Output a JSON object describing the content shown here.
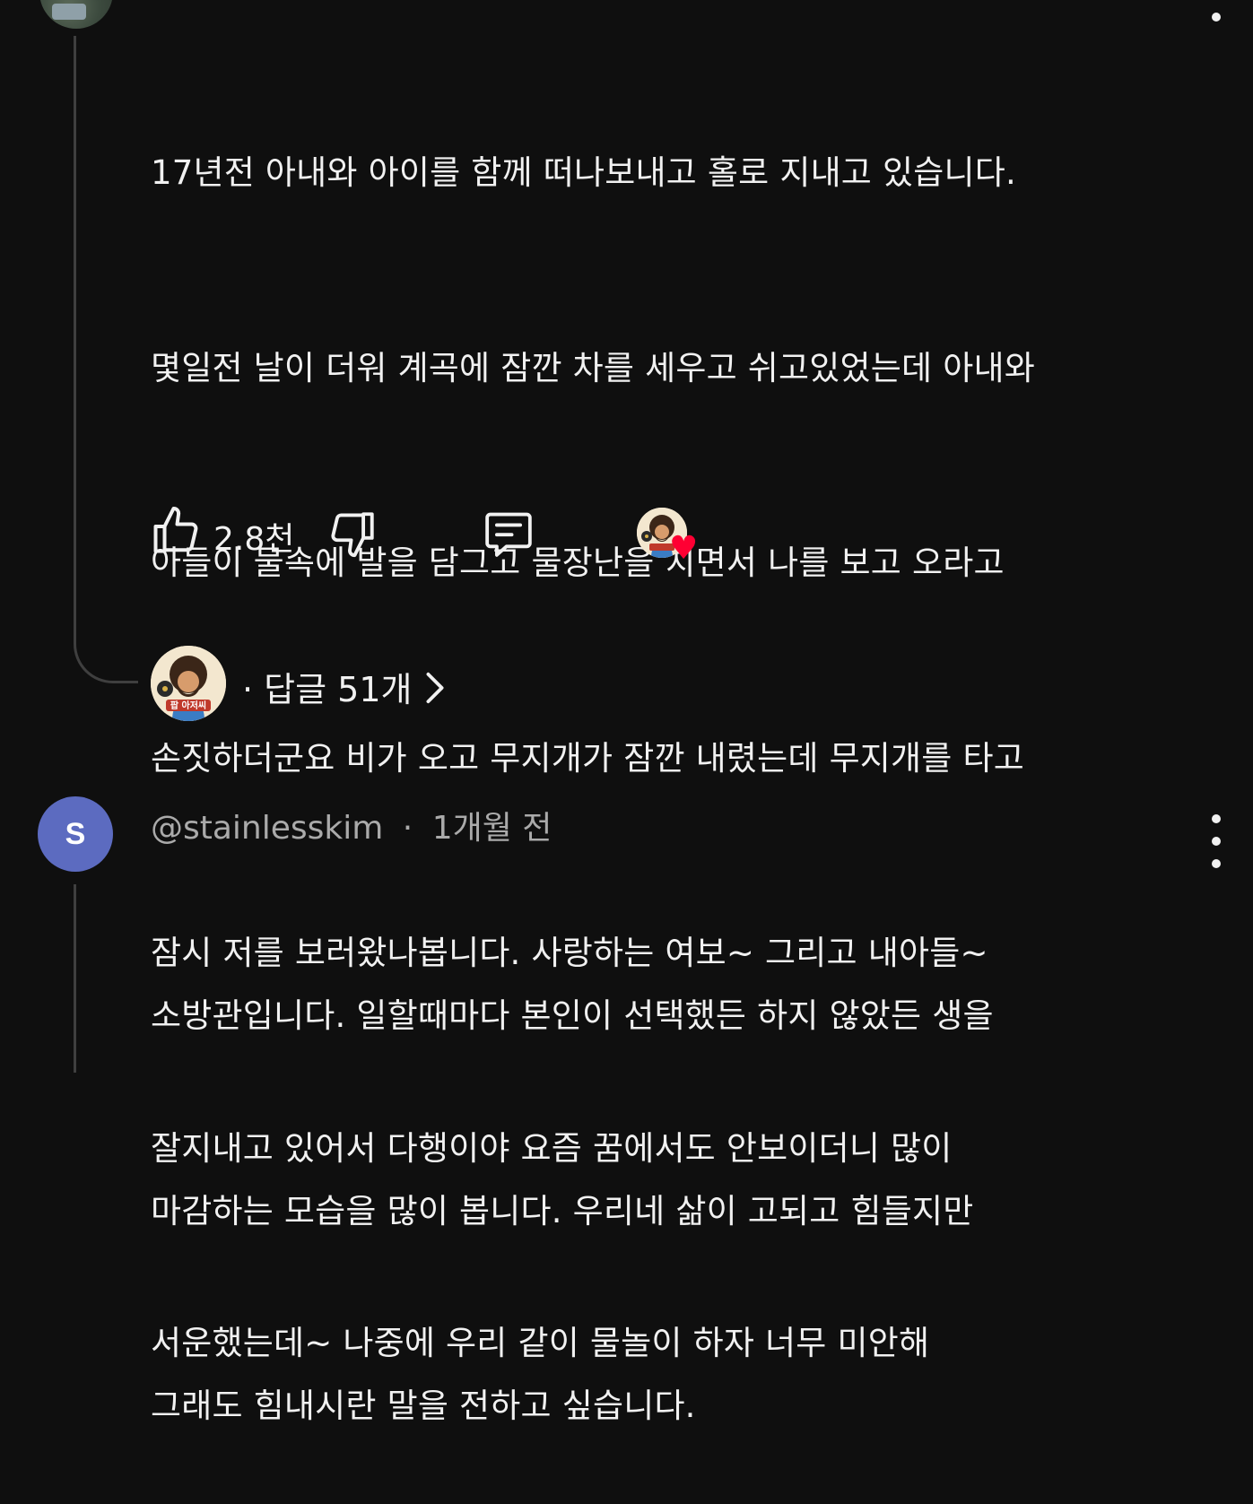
{
  "comment1": {
    "lines": [
      "17년전 아내와 아이를 함께 떠나보내고 홀로 지내고 있습니다.",
      "몇일전 날이 더워 계곡에 잠깐 차를 세우고 쉬고있었는데 아내와",
      "아들이 물속에 발을 담그고 물장난을 치면서 나를 보고 오라고",
      "손짓하더군요 비가 오고 무지개가 잠깐 내렸는데 무지개를 타고",
      "잠시 저를 보러왔나봅니다. 사랑하는 여보~ 그리고 내아들~",
      "잘지내고 있어서 다행이야 요즘 꿈에서도 안보이더니 많이",
      "서운했는데~ 나중에 우리 같이 물놀이 하자 너무 미안해"
    ],
    "like_count": "2.8천",
    "icons": {
      "like": "thumb-up-icon",
      "dislike": "thumb-down-icon",
      "reply": "comment-icon",
      "creator_heart": "heart-icon"
    },
    "creator_avatar_text": "팝 아저씨",
    "replies_label": "· 답글 51개",
    "replies_chevron": "›"
  },
  "comment2": {
    "avatar_letter": "S",
    "author": "@stainlesskim",
    "separator": "·",
    "time": "1개월 전",
    "lines": [
      "소방관입니다. 일할때마다 본인이 선택했든 하지 않았든 생을",
      "마감하는 모습을 많이 봅니다. 우리네 삶이 고되고 힘들지만",
      "그래도 힘내시란 말을 전하고 싶습니다."
    ]
  },
  "colors": {
    "background": "#0f0f0f",
    "text": "#f1f1f1",
    "meta_text": "#aaaaaa",
    "avatar_s": "#5c6bc0",
    "heart": "#ff0033",
    "thread_line": "#3f3f3f"
  }
}
